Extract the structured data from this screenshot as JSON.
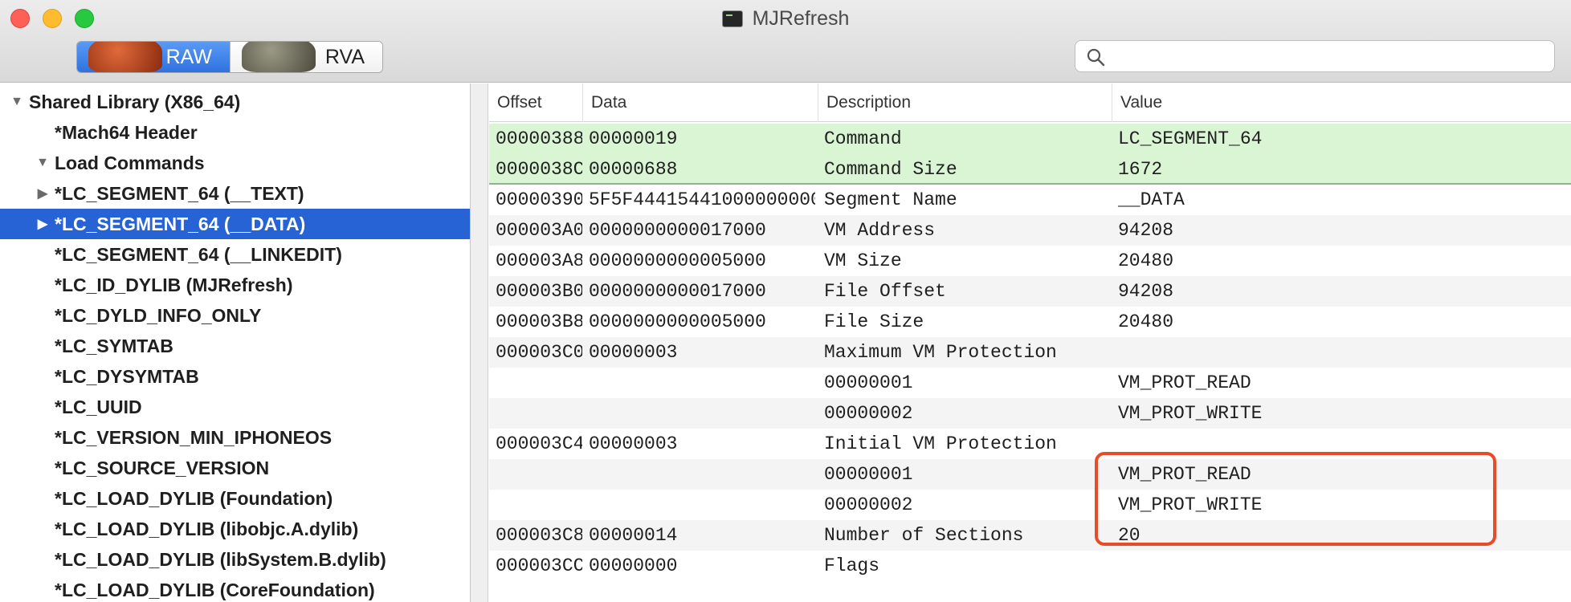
{
  "window": {
    "title": "MJRefresh",
    "title_icon": "terminal-icon"
  },
  "toolbar": {
    "segments": [
      {
        "label": "RAW",
        "active": true
      },
      {
        "label": "RVA",
        "active": false
      }
    ],
    "search": {
      "value": "",
      "placeholder": ""
    }
  },
  "sidebar": {
    "items": [
      {
        "label": "Shared Library  (X86_64)",
        "disclosure": "▼",
        "level": 0,
        "selected": false
      },
      {
        "label": "*Mach64 Header",
        "disclosure": "",
        "level": 1,
        "selected": false
      },
      {
        "label": "Load Commands",
        "disclosure": "▼",
        "level": 1,
        "selected": false
      },
      {
        "label": "*LC_SEGMENT_64 (__TEXT)",
        "disclosure": "▶",
        "level": 2,
        "selected": false
      },
      {
        "label": "*LC_SEGMENT_64 (__DATA)",
        "disclosure": "▶",
        "level": 2,
        "selected": true
      },
      {
        "label": "*LC_SEGMENT_64 (__LINKEDIT)",
        "disclosure": "",
        "level": 2,
        "selected": false
      },
      {
        "label": "*LC_ID_DYLIB (MJRefresh)",
        "disclosure": "",
        "level": 2,
        "selected": false
      },
      {
        "label": "*LC_DYLD_INFO_ONLY",
        "disclosure": "",
        "level": 2,
        "selected": false
      },
      {
        "label": "*LC_SYMTAB",
        "disclosure": "",
        "level": 2,
        "selected": false
      },
      {
        "label": "*LC_DYSYMTAB",
        "disclosure": "",
        "level": 2,
        "selected": false
      },
      {
        "label": "*LC_UUID",
        "disclosure": "",
        "level": 2,
        "selected": false
      },
      {
        "label": "*LC_VERSION_MIN_IPHONEOS",
        "disclosure": "",
        "level": 2,
        "selected": false
      },
      {
        "label": "*LC_SOURCE_VERSION",
        "disclosure": "",
        "level": 2,
        "selected": false
      },
      {
        "label": "*LC_LOAD_DYLIB (Foundation)",
        "disclosure": "",
        "level": 2,
        "selected": false
      },
      {
        "label": "*LC_LOAD_DYLIB (libobjc.A.dylib)",
        "disclosure": "",
        "level": 2,
        "selected": false
      },
      {
        "label": "*LC_LOAD_DYLIB (libSystem.B.dylib)",
        "disclosure": "",
        "level": 2,
        "selected": false
      },
      {
        "label": "*LC_LOAD_DYLIB (CoreFoundation)",
        "disclosure": "",
        "level": 2,
        "selected": false
      }
    ]
  },
  "table": {
    "columns": [
      "Offset",
      "Data",
      "Description",
      "Value"
    ],
    "rows": [
      {
        "offset": "00000388",
        "data": "00000019",
        "description": "Command",
        "value": "LC_SEGMENT_64",
        "highlight": true
      },
      {
        "offset": "0000038C",
        "data": "00000688",
        "description": "Command Size",
        "value": "1672",
        "highlight": true
      },
      {
        "offset": "00000390",
        "data": "5F5F44415441000000000…",
        "description": "Segment Name",
        "value": "__DATA",
        "highlight": false
      },
      {
        "offset": "000003A0",
        "data": "0000000000017000",
        "description": "VM Address",
        "value": "94208",
        "highlight": false
      },
      {
        "offset": "000003A8",
        "data": "0000000000005000",
        "description": "VM Size",
        "value": "20480",
        "highlight": false
      },
      {
        "offset": "000003B0",
        "data": "0000000000017000",
        "description": "File Offset",
        "value": "94208",
        "highlight": false
      },
      {
        "offset": "000003B8",
        "data": "0000000000005000",
        "description": "File Size",
        "value": "20480",
        "highlight": false
      },
      {
        "offset": "000003C0",
        "data": "00000003",
        "description": "Maximum VM Protection",
        "value": "",
        "highlight": false
      },
      {
        "offset": "",
        "data": "",
        "description": "00000001",
        "value": "VM_PROT_READ",
        "highlight": false
      },
      {
        "offset": "",
        "data": "",
        "description": "00000002",
        "value": "VM_PROT_WRITE",
        "highlight": false
      },
      {
        "offset": "000003C4",
        "data": "00000003",
        "description": "Initial VM Protection",
        "value": "",
        "highlight": false
      },
      {
        "offset": "",
        "data": "",
        "description": "00000001",
        "value": "VM_PROT_READ",
        "highlight": false
      },
      {
        "offset": "",
        "data": "",
        "description": "00000002",
        "value": "VM_PROT_WRITE",
        "highlight": false
      },
      {
        "offset": "000003C8",
        "data": "00000014",
        "description": "Number of Sections",
        "value": "20",
        "highlight": false
      },
      {
        "offset": "000003CC",
        "data": "00000000",
        "description": "Flags",
        "value": "",
        "highlight": false
      }
    ]
  },
  "colors": {
    "selection": "#2863d6",
    "highlight_row": "#d9f5d4",
    "annotation": "#e84b2a"
  }
}
